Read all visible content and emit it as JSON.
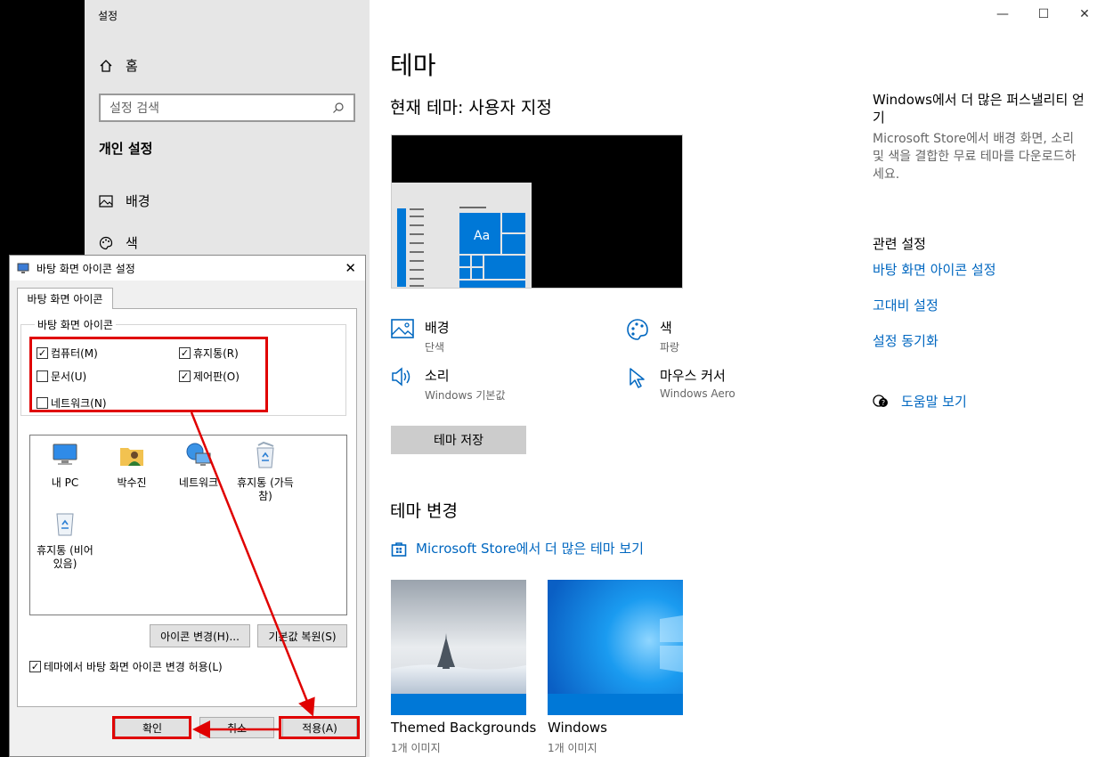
{
  "settings": {
    "window_title": "설정",
    "nav": {
      "home": "홈",
      "search_placeholder": "설정 검색",
      "section": "개인 설정",
      "items": [
        {
          "label": "배경"
        },
        {
          "label": "색"
        }
      ]
    },
    "page_title": "테마",
    "current_theme": "현재 테마: 사용자 지정",
    "preview_sample": "Aa",
    "props": {
      "background": {
        "label": "배경",
        "value": "단색"
      },
      "color": {
        "label": "색",
        "value": "파랑"
      },
      "sound": {
        "label": "소리",
        "value": "Windows 기본값"
      },
      "cursor": {
        "label": "마우스 커서",
        "value": "Windows Aero"
      }
    },
    "save_button": "테마 저장",
    "change_title": "테마 변경",
    "store_link": "Microsoft Store에서 더 많은 테마 보기",
    "themes": [
      {
        "name": "Themed Backgrounds",
        "count": "1개 이미지"
      },
      {
        "name": "Windows",
        "count": "1개 이미지"
      }
    ],
    "sidebar": {
      "more_title": "Windows에서 더 많은 퍼스낼리티 얻기",
      "more_desc": "Microsoft Store에서 배경 화면, 소리 및 색을 결합한 무료 테마를 다운로드하세요.",
      "related_title": "관련 설정",
      "links": [
        "바탕 화면 아이콘 설정",
        "고대비 설정",
        "설정 동기화"
      ],
      "help": "도움말 보기"
    }
  },
  "dialog": {
    "title": "바탕 화면 아이콘 설정",
    "tab": "바탕 화면 아이콘",
    "group_label": "바탕 화면 아이콘",
    "checkboxes": [
      {
        "label": "컴퓨터(M)",
        "checked": true
      },
      {
        "label": "휴지통(R)",
        "checked": true
      },
      {
        "label": "문서(U)",
        "checked": false
      },
      {
        "label": "제어판(O)",
        "checked": true
      },
      {
        "label": "네트워크(N)",
        "checked": false
      }
    ],
    "icons": [
      {
        "line1": "내 PC",
        "line2": ""
      },
      {
        "line1": "박수진",
        "line2": ""
      },
      {
        "line1": "네트워크",
        "line2": ""
      },
      {
        "line1": "휴지통 (가득",
        "line2": "참)"
      },
      {
        "line1": "휴지통 (비어",
        "line2": "있음)"
      }
    ],
    "change_icon": "아이콘 변경(H)...",
    "restore_default": "기본값 복원(S)",
    "allow_themes": "테마에서 바탕 화면 아이콘 변경 허용(L)",
    "allow_themes_checked": true,
    "ok": "확인",
    "cancel": "취소",
    "apply": "적용(A)"
  },
  "colors": {
    "accent": "#0067c0",
    "tile_blue": "#0078d7",
    "annotation_red": "#e00000"
  }
}
